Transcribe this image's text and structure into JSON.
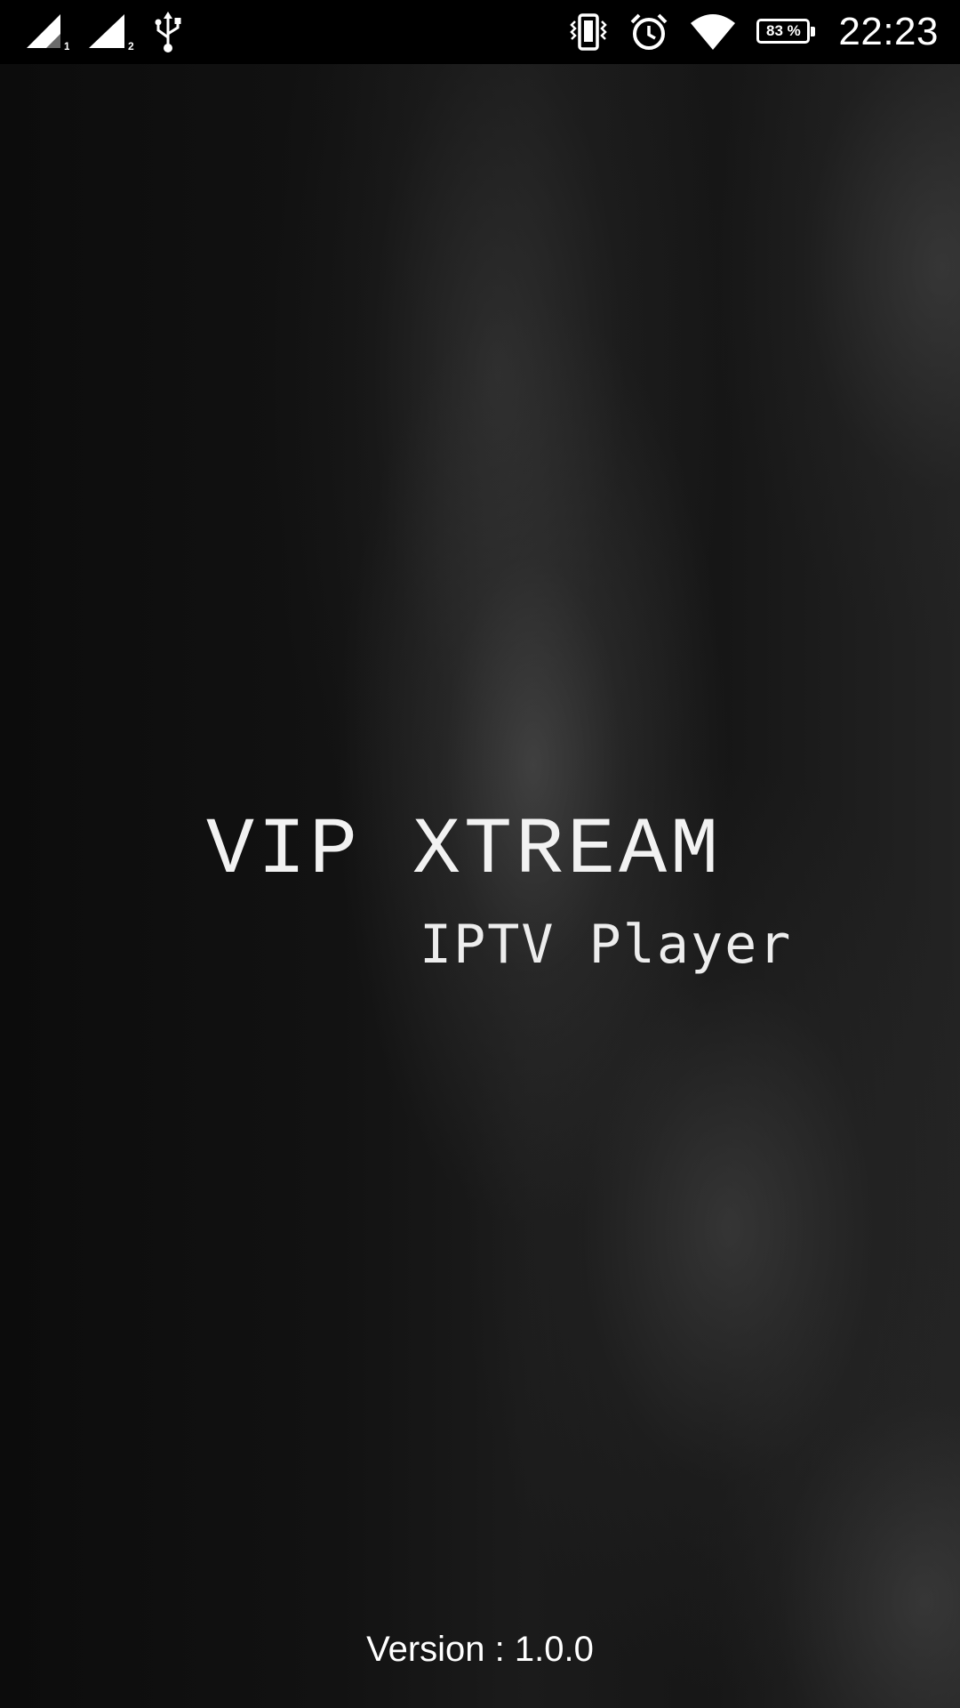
{
  "status_bar": {
    "sim1_label": "1",
    "sim2_label": "2",
    "icons": [
      "signal-sim1-icon",
      "signal-sim2-icon",
      "usb-icon",
      "vibrate-icon",
      "alarm-icon",
      "wifi-icon",
      "battery-icon"
    ],
    "battery_percent_text": "83 %",
    "battery_level": 0.83,
    "time": "22:23"
  },
  "splash": {
    "title": "VIP XTREAM",
    "subtitle": "IPTV Player",
    "version": "Version : 1.0.0"
  },
  "colors": {
    "status_bar_bg": "#000000",
    "text": "#ffffff",
    "background_dark": "#0b0b0b",
    "background_light": "#4a4a4a"
  }
}
